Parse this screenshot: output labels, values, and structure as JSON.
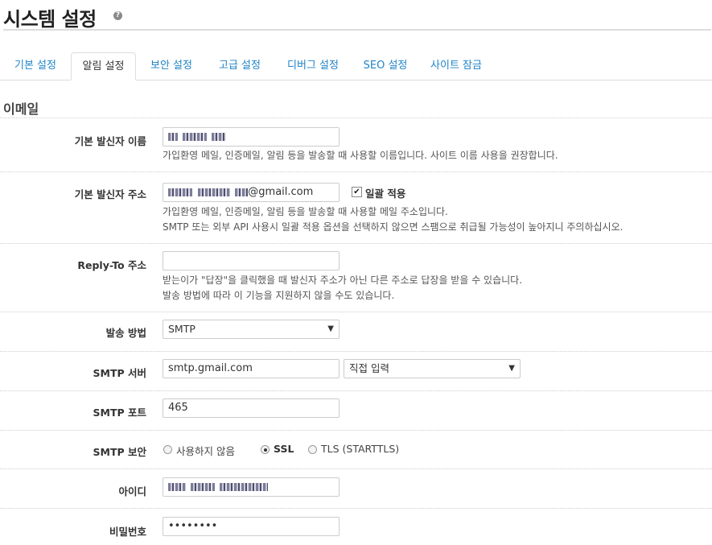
{
  "header": {
    "title": "시스템 설정",
    "help_icon": "question-circle-icon"
  },
  "tabs": [
    {
      "label": "기본 설정",
      "active": false
    },
    {
      "label": "알림 설정",
      "active": true
    },
    {
      "label": "보안 설정",
      "active": false
    },
    {
      "label": "고급 설정",
      "active": false
    },
    {
      "label": "디버그 설정",
      "active": false
    },
    {
      "label": "SEO 설정",
      "active": false
    },
    {
      "label": "사이트 잠금",
      "active": false
    }
  ],
  "section": {
    "title": "이메일"
  },
  "fields": {
    "sender_name": {
      "label": "기본 발신자 이름",
      "value": "",
      "help": "가입환영 메일, 인증메일, 알림 등을 발송할 때 사용할 이름입니다. 사이트 이름 사용을 권장합니다."
    },
    "sender_address": {
      "label": "기본 발신자 주소",
      "value_suffix": "@gmail.com",
      "bulk_apply_label": "일괄 적용",
      "bulk_apply_checked": true,
      "help_line1": "가입환영 메일, 인증메일, 알림 등을 발송할 때 사용할 메일 주소입니다.",
      "help_line2": "SMTP 또는 외부 API 사용시 일괄 적용 옵션을 선택하지 않으면 스팸으로 취급될 가능성이 높아지니 주의하십시오."
    },
    "reply_to": {
      "label": "Reply-To 주소",
      "value": "",
      "help_line1": "받는이가 \"답장\"을 클릭했을 때 발신자 주소가 아닌 다른 주소로 답장을 받을 수 있습니다.",
      "help_line2": "발송 방법에 따라 이 기능을 지원하지 않을 수도 있습니다."
    },
    "send_method": {
      "label": "발송 방법",
      "selected": "SMTP"
    },
    "smtp_server": {
      "label": "SMTP 서버",
      "value": "smtp.gmail.com",
      "preset_selected": "직접 입력"
    },
    "smtp_port": {
      "label": "SMTP 포트",
      "value": "465"
    },
    "smtp_security": {
      "label": "SMTP 보안",
      "options": [
        {
          "label": "사용하지 않음",
          "checked": false
        },
        {
          "label": "SSL",
          "checked": true
        },
        {
          "label": "TLS (STARTTLS)",
          "checked": false
        }
      ]
    },
    "smtp_id": {
      "label": "아이디",
      "value": ""
    },
    "smtp_password": {
      "label": "비밀번호",
      "value": "••••••••"
    }
  }
}
